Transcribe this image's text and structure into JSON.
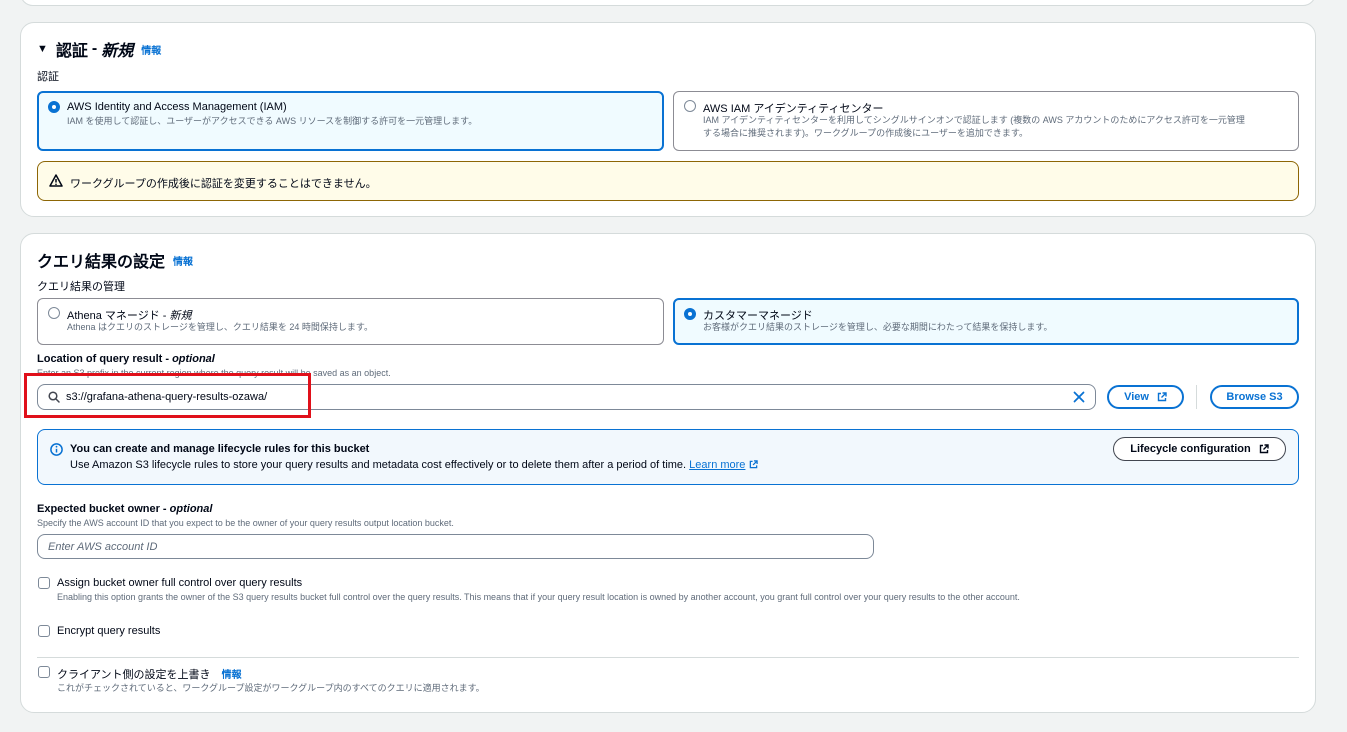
{
  "auth_section": {
    "title": "認証",
    "title_suffix": "新規",
    "info": "情報",
    "field_label": "認証",
    "options": [
      {
        "title": "AWS Identity and Access Management (IAM)",
        "desc": "IAM を使用して認証し、ユーザーがアクセスできる AWS リソースを制御する許可を一元管理します。",
        "selected": true
      },
      {
        "title": "AWS IAM アイデンティティセンター",
        "desc_line1": "IAM アイデンティティセンターを利用してシングルサインオンで認証します (複数の AWS アカウントのためにアクセス許可を一元管理",
        "desc_line2": "する場合に推奨されます)。ワークグループの作成後にユーザーを追加できます。",
        "selected": false
      }
    ],
    "warning": "ワークグループの作成後に認証を変更することはできません。"
  },
  "query_section": {
    "title": "クエリ結果の設定",
    "info": "情報",
    "mgmt_label": "クエリ結果の管理",
    "options": [
      {
        "title": "Athena マネージド - ",
        "title_suffix": "新規",
        "desc": "Athena はクエリのストレージを管理し、クエリ結果を 24 時間保持します。",
        "selected": false
      },
      {
        "title": "カスタマーマネージド",
        "desc": "お客様がクエリ結果のストレージを管理し、必要な期間にわたって結果を保持します。",
        "selected": true
      }
    ],
    "location_label": "Location of query result - ",
    "location_optional": "optional",
    "location_desc": "Enter an S3 prefix in the current region where the query result will be saved as an object.",
    "location_value": "s3://grafana-athena-query-results-ozawa/",
    "view_button": "View",
    "browse_button": "Browse S3",
    "lifecycle": {
      "title": "You can create and manage lifecycle rules for this bucket",
      "body": "Use Amazon S3 lifecycle rules to store your query results and metadata cost effectively or to delete them after a period of time.",
      "learn_more": "Learn more",
      "button": "Lifecycle configuration"
    },
    "owner_label": "Expected bucket owner - ",
    "owner_optional": "optional",
    "owner_desc": "Specify the AWS account ID that you expect to be the owner of your query results output location bucket.",
    "owner_placeholder": "Enter AWS account ID",
    "assign_label": "Assign bucket owner full control over query results",
    "assign_desc": "Enabling this option grants the owner of the S3 query results bucket full control over the query results. This means that if your query result location is owned by another account, you grant full control over your query results to the other account.",
    "encrypt_label": "Encrypt query results",
    "override_label": "クライアント側の設定を上書き",
    "override_info": "情報",
    "override_desc": "これがチェックされていると、ワークグループ設定がワークグループ内のすべてのクエリに適用されます。"
  },
  "colors": {
    "accent": "#0972d3",
    "highlight": "#e0101a",
    "warning_border": "#8d6605"
  }
}
